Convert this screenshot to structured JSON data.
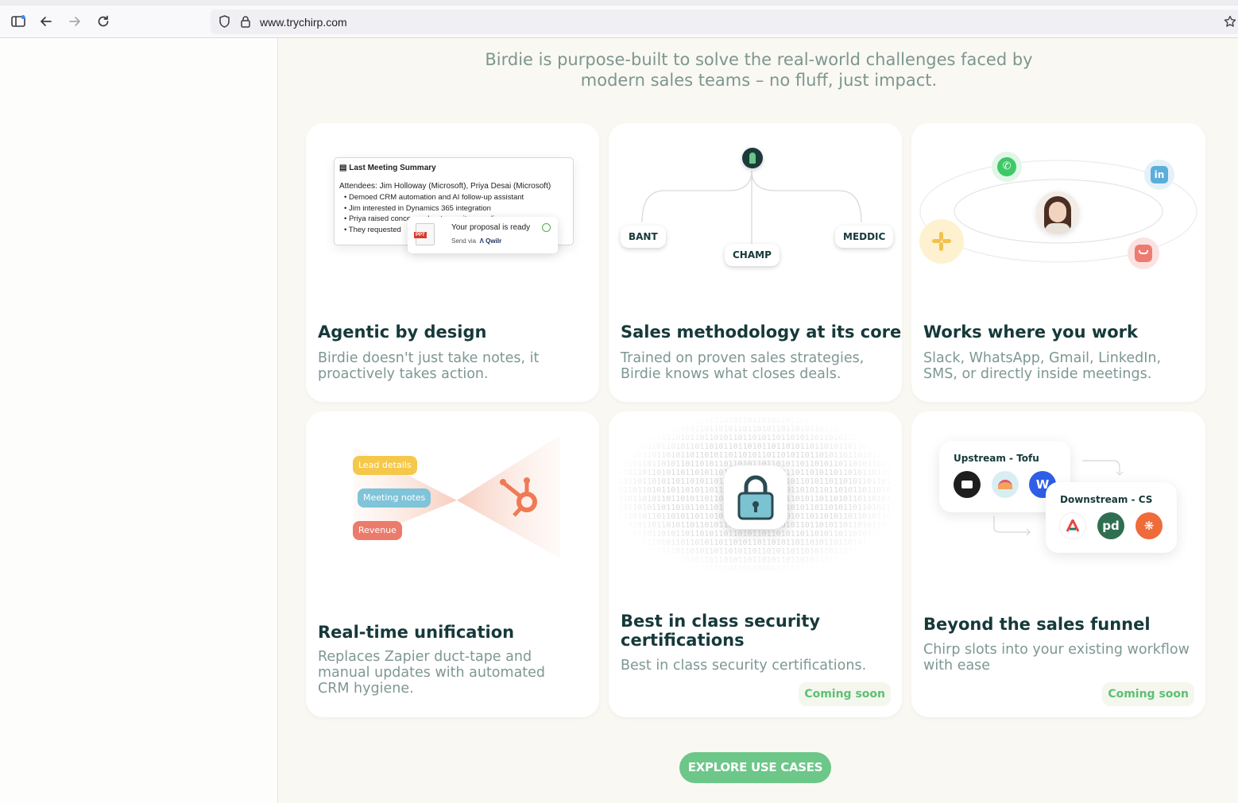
{
  "browser": {
    "url": "www.trychirp.com"
  },
  "intro": {
    "line1": "Birdie is purpose-built to solve the real-world challenges faced by",
    "line2": "modern sales teams – no fluff, just impact."
  },
  "cards": [
    {
      "title": "Agentic by design",
      "desc_line1": "Birdie doesn't just take notes, it",
      "desc_line2": "proactively takes action.",
      "illustration": {
        "summary_title": "Last Meeting Summary",
        "attendees": "Attendees: Jim Holloway (Microsoft), Priya Desai (Microsoft)",
        "bullets": [
          "Demoed CRM automation and AI follow-up assistant",
          "Jim interested in Dynamics 365 integration",
          "Priya raised concerns about security compliance",
          "They requested"
        ],
        "proposal_title": "Your proposal is ready",
        "proposal_send": "Send via",
        "proposal_brand": "Qwilr",
        "file_label": "PPT"
      }
    },
    {
      "title": "Sales methodology at its core",
      "desc_line1": "Trained on proven sales strategies,",
      "desc_line2": "Birdie knows what closes deals.",
      "tags": [
        "BANT",
        "CHAMP",
        "MEDDIC"
      ]
    },
    {
      "title": "Works where you work",
      "desc_line1": "Slack, WhatsApp, Gmail, LinkedIn,",
      "desc_line2": "SMS, or directly inside meetings.",
      "icons": [
        "whatsapp-icon",
        "linkedin-icon",
        "slack-icon",
        "mail-icon"
      ]
    },
    {
      "title": "Real-time unification",
      "desc_line1": "Replaces Zapier duct-tape and",
      "desc_line2": "manual updates with automated",
      "desc_line3": "CRM hygiene.",
      "pills": [
        "Lead details",
        "Meeting notes",
        "Revenue"
      ]
    },
    {
      "title_line1": "Best in class security",
      "title_line2": "certifications",
      "desc_line1": "Best in class security certifications.",
      "badge": "Coming soon"
    },
    {
      "title": "Beyond the sales funnel",
      "desc_line1": "Chirp slots into your existing workflow",
      "desc_line2": "with ease",
      "badge": "Coming soon",
      "upstream_label": "Upstream - Tofu",
      "downstream_label": "Downstream - CS"
    }
  ],
  "cta": {
    "label": "EXPLORE USE CASES"
  },
  "colors": {
    "accent_green": "#6cc789",
    "title_dark": "#16393a",
    "muted_teal": "#7e9793",
    "page_bg": "#faf8f2"
  }
}
